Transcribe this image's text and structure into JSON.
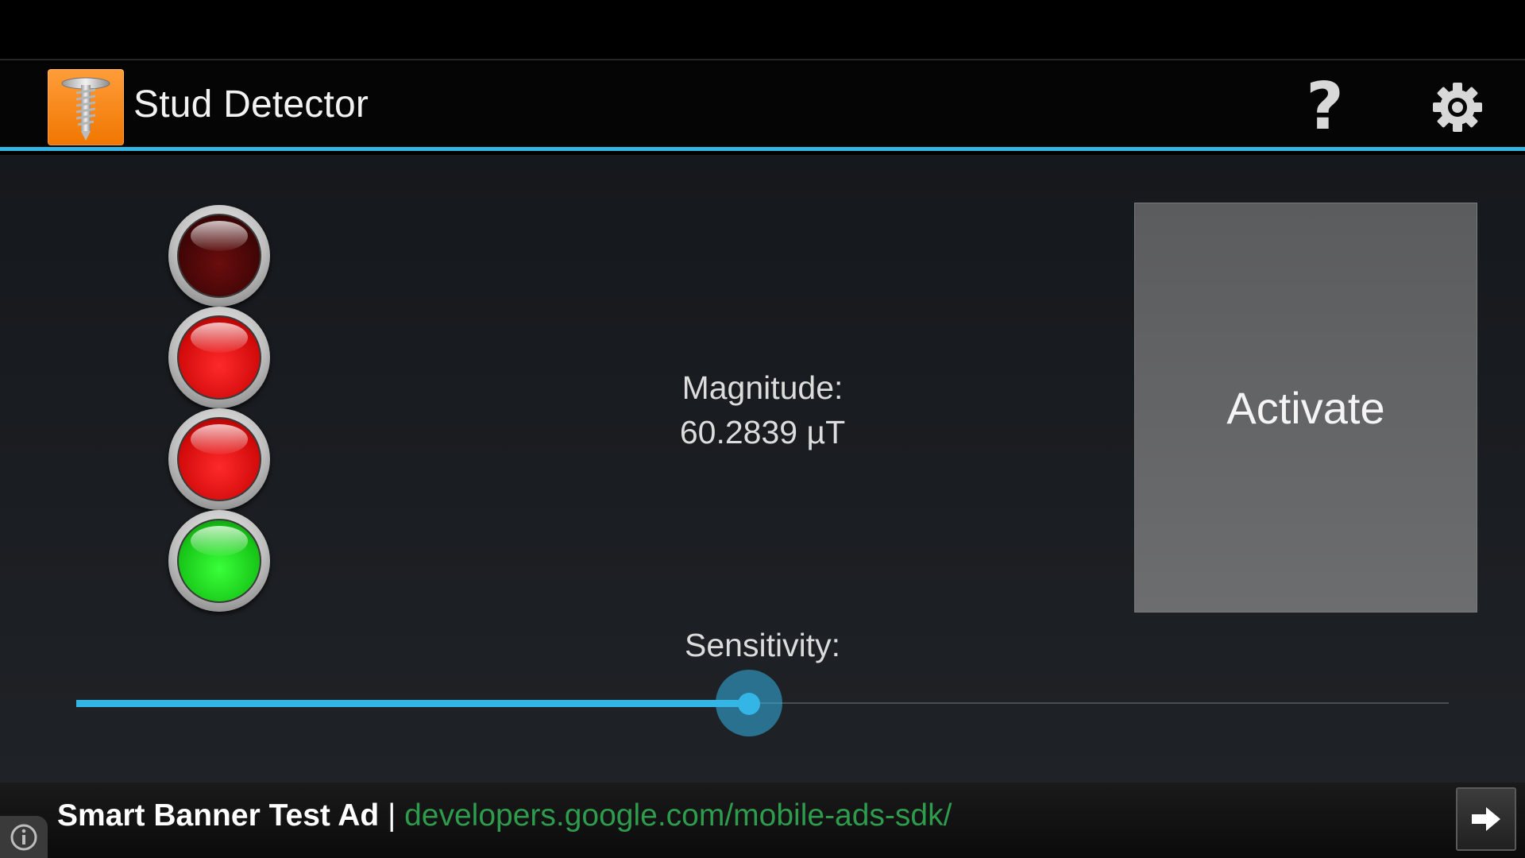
{
  "app": {
    "title": "Stud Detector",
    "accent_color": "#33b5e5"
  },
  "toolbar": {
    "help_label": "?",
    "help_icon": "question-mark-icon",
    "settings_icon": "gear-icon"
  },
  "indicator_lights": [
    {
      "color": "dark-red",
      "state": "off"
    },
    {
      "color": "red",
      "state": "on"
    },
    {
      "color": "red",
      "state": "on"
    },
    {
      "color": "green",
      "state": "on"
    }
  ],
  "magnitude": {
    "label": "Magnitude:",
    "value": "60.2839 µT"
  },
  "activate_button": {
    "label": "Activate"
  },
  "sensitivity": {
    "label": "Sensitivity:",
    "value_fraction": 0.49
  },
  "ad": {
    "title": "Smart Banner Test Ad",
    "separator": "|",
    "url": "developers.google.com/mobile-ads-sdk/",
    "info_icon": "info-icon",
    "arrow_icon": "arrow-right-icon"
  }
}
